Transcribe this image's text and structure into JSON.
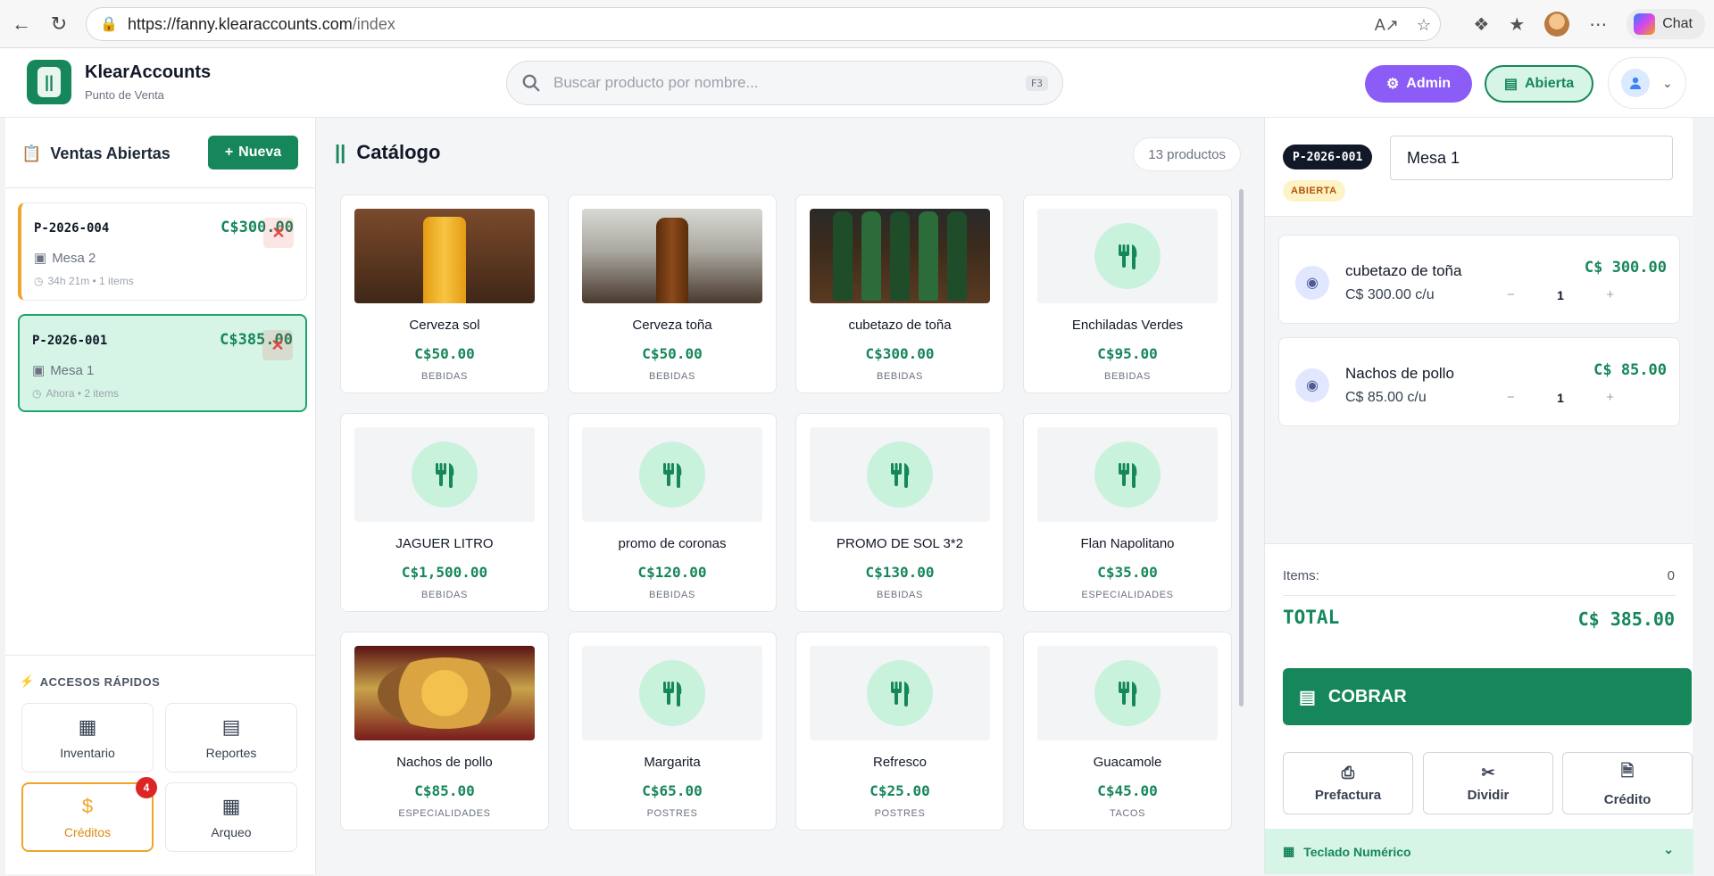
{
  "browser": {
    "url_host": "https://fanny.klearaccounts.com",
    "url_path": "/index",
    "chat_label": "Chat"
  },
  "header": {
    "brand": "KlearAccounts",
    "subtitle": "Punto de Venta",
    "search_placeholder": "Buscar producto por nombre...",
    "search_shortcut": "F3",
    "admin_label": "Admin",
    "caja_label": "Abierta"
  },
  "sidebar": {
    "title": "Ventas Abiertas",
    "new_button": "Nueva",
    "sales": [
      {
        "code": "P-2026-004",
        "total": "C$300.00",
        "mesa": "Mesa 2",
        "meta": "34h 21m • 1 items"
      },
      {
        "code": "P-2026-001",
        "total": "C$385.00",
        "mesa": "Mesa 1",
        "meta": "Ahora • 2 items"
      }
    ],
    "quick_title": "ACCESOS RÁPIDOS",
    "quick": [
      {
        "label": "Inventario"
      },
      {
        "label": "Reportes"
      },
      {
        "label": "Créditos",
        "badge": "4"
      },
      {
        "label": "Arqueo"
      }
    ]
  },
  "catalog": {
    "title": "Catálogo",
    "count": "13 productos",
    "products": [
      {
        "name": "Cerveza sol",
        "price": "C$50.00",
        "category": "BEBIDAS",
        "image": "sol-beer"
      },
      {
        "name": "Cerveza toña",
        "price": "C$50.00",
        "category": "BEBIDAS",
        "image": "tona-beer"
      },
      {
        "name": "cubetazo de toña",
        "price": "C$300.00",
        "category": "BEBIDAS",
        "image": "bottles"
      },
      {
        "name": "Enchiladas Verdes",
        "price": "C$95.00",
        "category": "BEBIDAS",
        "image": "fork-icon"
      },
      {
        "name": "JAGUER LITRO",
        "price": "C$1,500.00",
        "category": "BEBIDAS",
        "image": "fork-icon"
      },
      {
        "name": "promo de coronas",
        "price": "C$120.00",
        "category": "BEBIDAS",
        "image": "fork-icon"
      },
      {
        "name": "PROMO DE SOL 3*2",
        "price": "C$130.00",
        "category": "BEBIDAS",
        "image": "fork-icon"
      },
      {
        "name": "Flan Napolitano",
        "price": "C$35.00",
        "category": "ESPECIALIDADES",
        "image": "fork-icon"
      },
      {
        "name": "Nachos de pollo",
        "price": "C$85.00",
        "category": "ESPECIALIDADES",
        "image": "nachos"
      },
      {
        "name": "Margarita",
        "price": "C$65.00",
        "category": "POSTRES",
        "image": "fork-icon"
      },
      {
        "name": "Refresco",
        "price": "C$25.00",
        "category": "POSTRES",
        "image": "fork-icon"
      },
      {
        "name": "Guacamole",
        "price": "C$45.00",
        "category": "TACOS",
        "image": "fork-icon"
      }
    ]
  },
  "order": {
    "code": "P-2026-001",
    "mesa": "Mesa 1",
    "status": "ABIERTA",
    "items": [
      {
        "name": "cubetazo de toña",
        "unit": "C$ 300.00 c/u",
        "qty": "1",
        "total": "C$ 300.00"
      },
      {
        "name": "Nachos de pollo",
        "unit": "C$ 85.00 c/u",
        "qty": "1",
        "total": "C$ 85.00"
      }
    ],
    "items_label": "Items:",
    "items_count": "0",
    "total_label": "TOTAL",
    "total_value": "C$ 385.00",
    "cobrar": "COBRAR",
    "actions": [
      "Prefactura",
      "Dividir",
      "Crédito"
    ],
    "numpad_label": "Teclado Numérico"
  },
  "colors": {
    "primary": "#16875a",
    "admin": "#8b5cf6",
    "warning": "#f0a52a"
  }
}
